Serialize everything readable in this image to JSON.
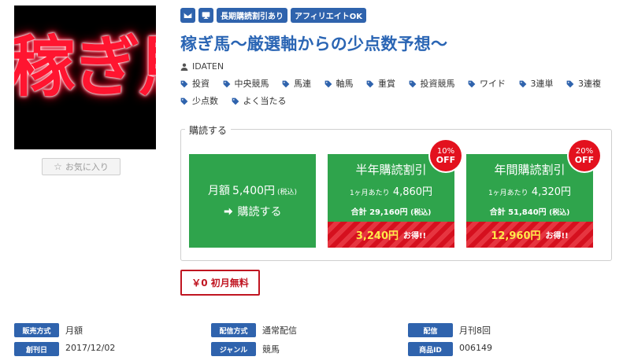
{
  "thumbnail": {
    "text": "稼ぎ馬"
  },
  "favorite": {
    "label": "お気に入り",
    "icon": "star-outline-icon"
  },
  "badges": [
    "長期購読割引あり",
    "アフィリエイトOK"
  ],
  "title": "稼ぎ馬～厳選軸からの少点数予想～",
  "author": "IDATEN",
  "tags": [
    "投資",
    "中央競馬",
    "馬連",
    "軸馬",
    "重賞",
    "投資競馬",
    "ワイド",
    "3連単",
    "3連複",
    "少点数",
    "よく当たる"
  ],
  "purchase": {
    "legend": "購読する",
    "monthly": {
      "prefix": "月額",
      "price": "5,400円",
      "tax": "(税込)",
      "cta": "購読する"
    },
    "half_year": {
      "name": "半年購読割引",
      "per_month_label": "1ヶ月あたり",
      "per_month_price": "4,860円",
      "total_label": "合計",
      "total_price": "29,160円",
      "tax": "(税込)",
      "saving": "3,240円",
      "saving_label": "お得!!",
      "discount": "10%",
      "off": "OFF"
    },
    "year": {
      "name": "年間購読割引",
      "per_month_label": "1ヶ月あたり",
      "per_month_price": "4,320円",
      "total_label": "合計",
      "total_price": "51,840円",
      "tax": "(税込)",
      "saving": "12,960円",
      "saving_label": "お得!!",
      "discount": "20%",
      "off": "OFF"
    }
  },
  "free_badge": "￥0 初月無料",
  "info": {
    "sales_method_label": "販売方式",
    "sales_method": "月額",
    "delivery_method_label": "配信方式",
    "delivery_method": "通常配信",
    "delivery_label": "配信",
    "delivery": "月刊8回",
    "start_date_label": "創刊日",
    "start_date": "2017/12/02",
    "genre_label": "ジャンル",
    "genre": "競馬",
    "product_id_label": "商品ID",
    "product_id": "006149"
  },
  "colors": {
    "primary": "#2f63ad",
    "title": "#2a65b4",
    "green": "#2fa44c",
    "red": "#d5101e",
    "gold": "#ffe94a"
  }
}
